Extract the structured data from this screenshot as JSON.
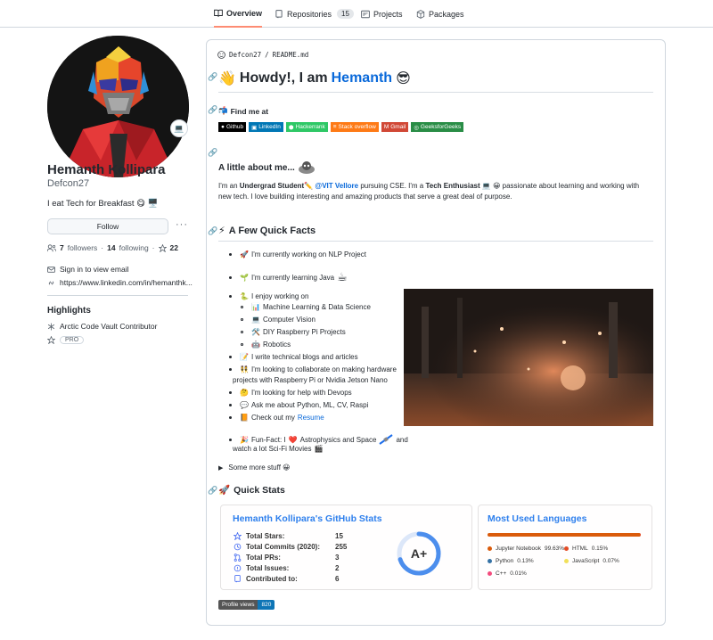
{
  "tabs": [
    {
      "label": "Overview",
      "icon": "book-icon",
      "active": true
    },
    {
      "label": "Repositories",
      "icon": "repo-icon",
      "count": "15"
    },
    {
      "label": "Projects",
      "icon": "project-icon"
    },
    {
      "label": "Packages",
      "icon": "package-icon"
    }
  ],
  "profile": {
    "full_name": "Hemanth Kollipara",
    "username": "Defcon27",
    "bio": "I eat Tech for Breakfast 😋 🖥️",
    "status_emoji": "💻",
    "follow_label": "Follow",
    "more_label": "···",
    "followers_count": "7",
    "followers_label": "followers",
    "following_count": "14",
    "following_label": "following",
    "stars_count": "22",
    "separator": "·",
    "email_label": "Sign in to view email",
    "website": "https://www.linkedin.com/in/hemanthk...",
    "highlights_title": "Highlights",
    "highlight_item": "Arctic Code Vault Contributor",
    "pro_label": "PRO"
  },
  "readme": {
    "path_user": "Defcon27",
    "path_sep": "/",
    "path_file": "README.md",
    "greeting_emoji": "👋",
    "greeting": "Howdy!, I am",
    "name": "Hemanth",
    "greeting_emoji_end": "😎",
    "find_me_emoji": "📬",
    "find_me": "Find me at",
    "badges": [
      {
        "label": "Github",
        "color": "#000000",
        "icon": "github-icon"
      },
      {
        "label": "LinkedIn",
        "color": "#0077b5",
        "icon": "linkedin-icon"
      },
      {
        "label": "Hackerrank",
        "color": "#2ec866",
        "icon": "hackerrank-icon"
      },
      {
        "label": "Stack overflow",
        "color": "#fe7a16",
        "icon": "stackoverflow-icon"
      },
      {
        "label": "Gmail",
        "color": "#d14836",
        "icon": "gmail-icon"
      },
      {
        "label": "GeeksforGeeks",
        "color": "#298d46",
        "icon": "gfg-icon"
      }
    ],
    "about_title": "A little about me...",
    "about": {
      "p1": "I'm an ",
      "strong1": "Undergrad Student",
      "emoji1": "✏️ ",
      "link1": "@VIT Vellore",
      "p2": " pursuing CSE. I'm a ",
      "strong2": "Tech Enthusiast",
      "emoji2": " 💻 😀",
      "p3": " passionate about learning and working with new tech. I love building interesting and amazing products that serve a great deal of purpose."
    },
    "facts_emoji": "⚡",
    "facts_title": "A Few Quick Facts",
    "facts": {
      "f1_emoji": "🚀",
      "f1": "I'm currently working on NLP Project",
      "f2_emoji": "🌱",
      "f2": "I'm currently learning Java",
      "f2_end": "☕",
      "f3_emoji": "🐍",
      "f3": "I enjoy working on",
      "sub": [
        {
          "emoji": "📊",
          "text": "Machine Learning & Data Science"
        },
        {
          "emoji": "💻",
          "text": "Computer Vision"
        },
        {
          "emoji": "🛠️",
          "text": "DIY Raspberry Pi Projects"
        },
        {
          "emoji": "🤖",
          "text": "Robotics"
        }
      ],
      "f4_emoji": "📝",
      "f4": "I write technical blogs and articles",
      "f5_emoji": "👯",
      "f5a": "I'm looking to collaborate on making hardware",
      "f5b": "projects with Raspberry Pi or Nvidia Jetson Nano",
      "f6_emoji": "🤔",
      "f6": "I'm looking for help with Devops",
      "f7_emoji": "💬",
      "f7": "Ask me about Python, ML, CV, Raspi",
      "f8_emoji": "📙",
      "f8": "Check out my",
      "f8_link": "Resume",
      "f9_emoji": "🎉",
      "f9a": "Fun-Fact: I",
      "f9_heart": "❤️",
      "f9b": "Astrophysics and Space",
      "f9_end": "and",
      "f9c": "watch a lot Sci-Fi Movies",
      "f9_emoji_end": "🎬"
    },
    "details_label": "Some more stuff 😀",
    "stats_emoji": "🚀",
    "stats_title": "Quick Stats",
    "gh_stats": {
      "title": "Hemanth Kollipara's GitHub Stats",
      "rows": [
        {
          "icon": "star-icon",
          "label": "Total Stars:",
          "value": "15"
        },
        {
          "icon": "history-icon",
          "label": "Total Commits (2020):",
          "value": "255"
        },
        {
          "icon": "pr-icon",
          "label": "Total PRs:",
          "value": "3"
        },
        {
          "icon": "issue-icon",
          "label": "Total Issues:",
          "value": "2"
        },
        {
          "icon": "repo-icon",
          "label": "Contributed to:",
          "value": "6"
        }
      ],
      "rank": "A+",
      "rank_progress": 0.7
    },
    "languages": {
      "title": "Most Used Languages",
      "items": [
        {
          "name": "Jupyter Notebook",
          "percent": "99.63%",
          "color": "#DA5B0B"
        },
        {
          "name": "HTML",
          "percent": "0.15%",
          "color": "#e34c26"
        },
        {
          "name": "Python",
          "percent": "0.13%",
          "color": "#3572A5"
        },
        {
          "name": "JavaScript",
          "percent": "0.07%",
          "color": "#f1e05a"
        },
        {
          "name": "C++",
          "percent": "0.01%",
          "color": "#f34b7d"
        }
      ]
    },
    "views_label": "Profile views",
    "views_count": "820"
  }
}
